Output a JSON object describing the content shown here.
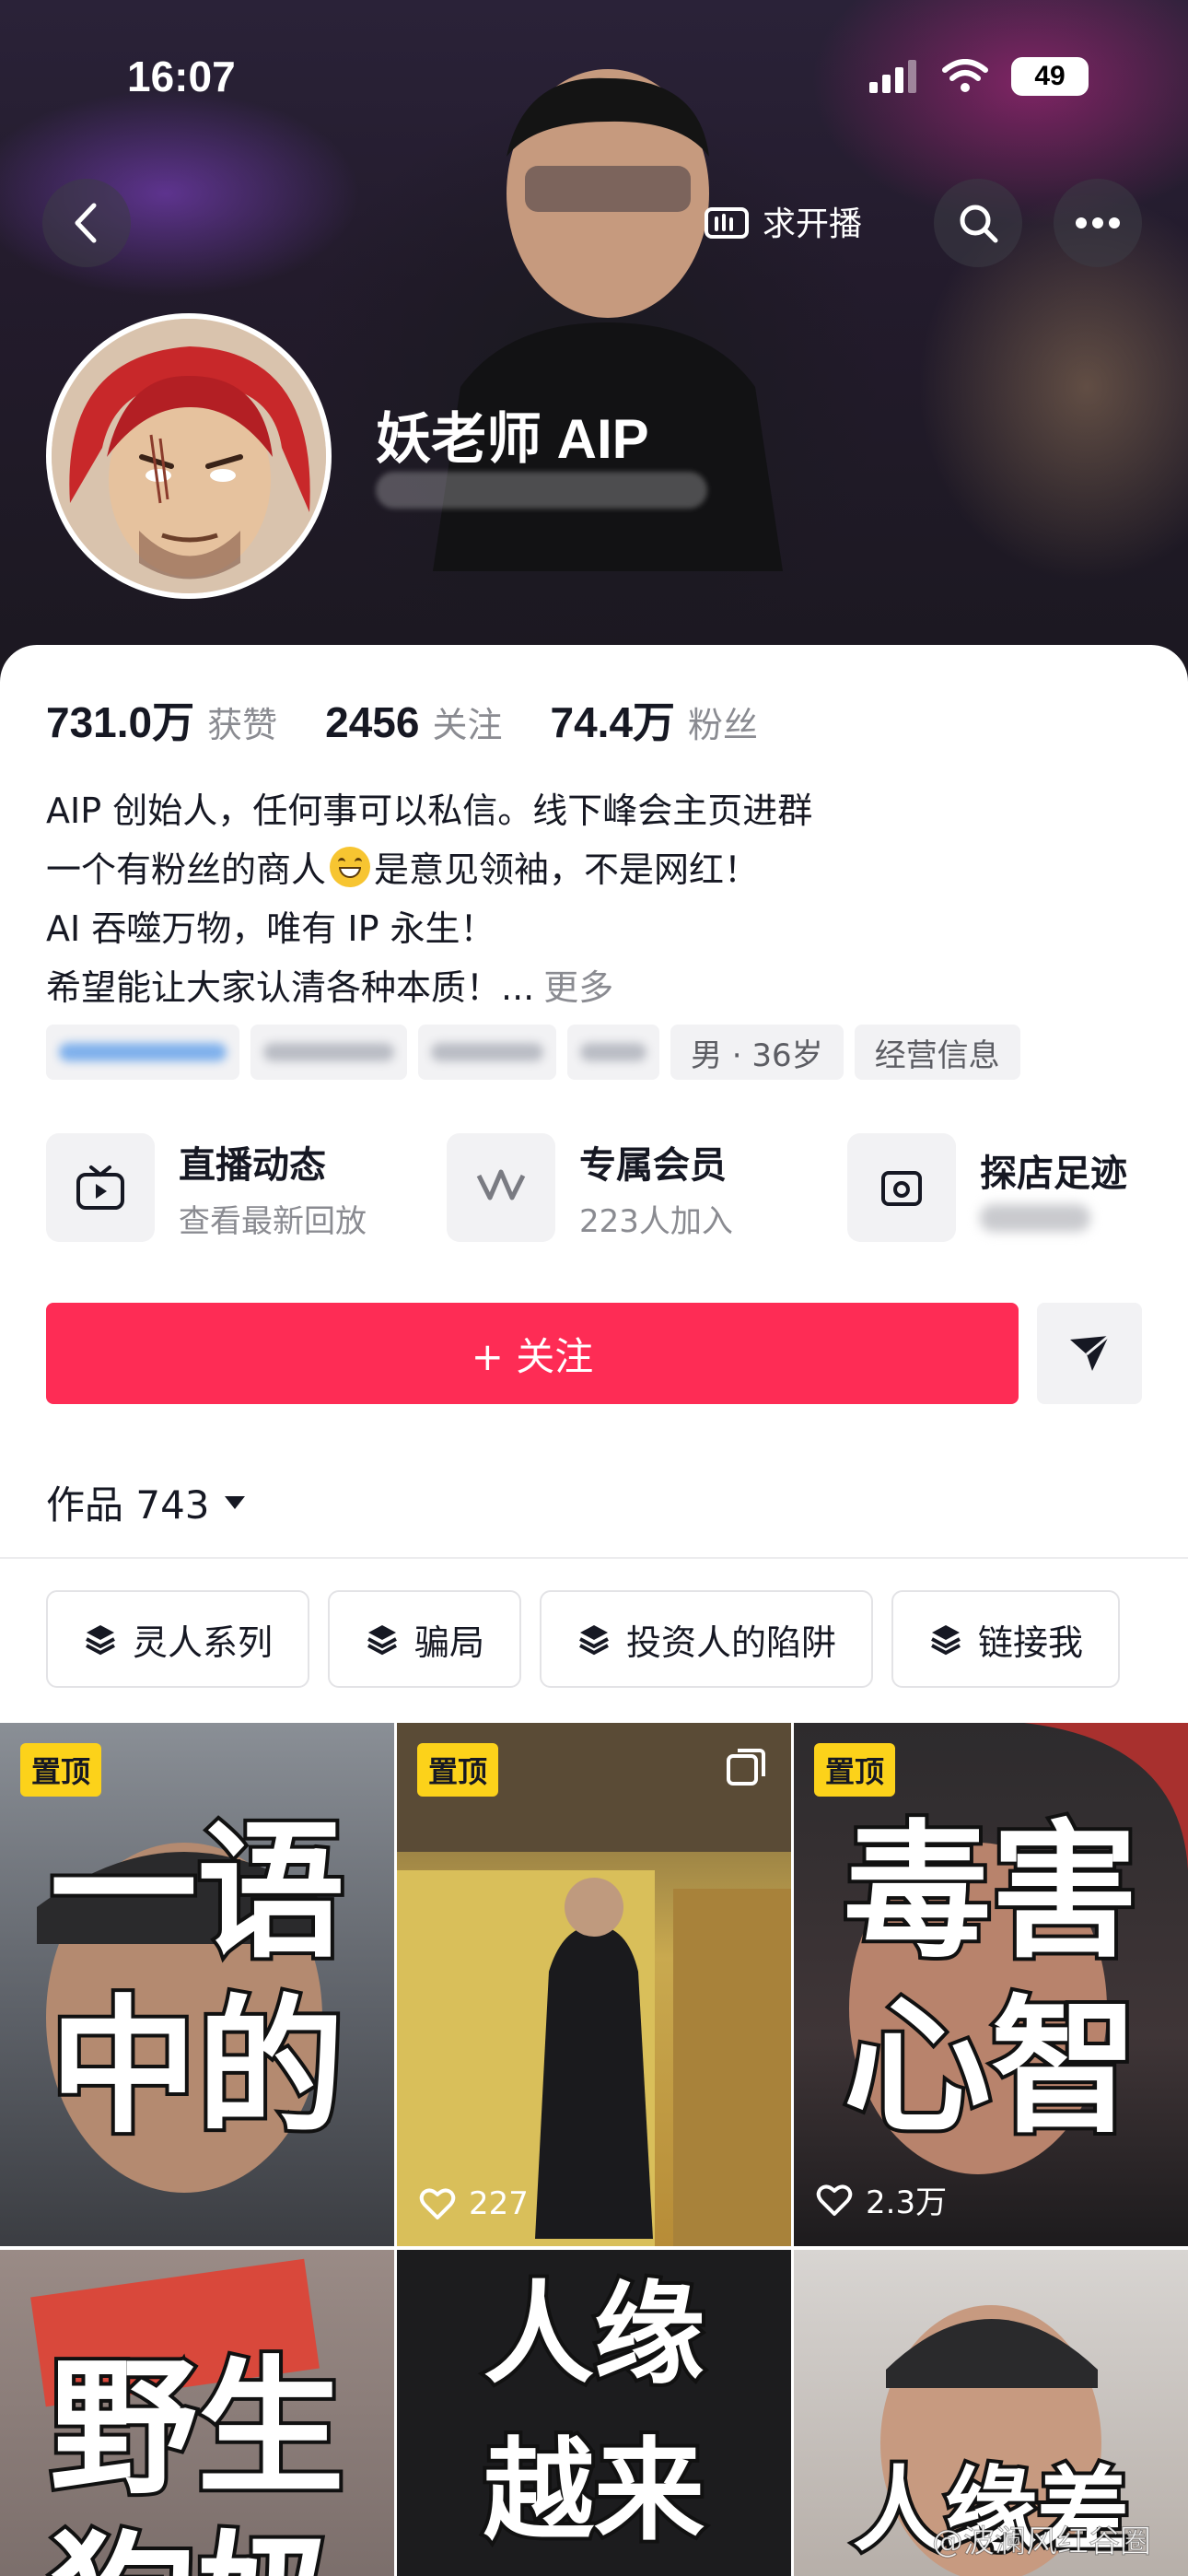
{
  "status_bar": {
    "time": "16:07",
    "battery": "49"
  },
  "header": {
    "live_request": "求开播"
  },
  "profile": {
    "name": "妖老师 AIP"
  },
  "stats": [
    {
      "value": "731.0万",
      "label": "获赞"
    },
    {
      "value": "2456",
      "label": "关注"
    },
    {
      "value": "74.4万",
      "label": "粉丝"
    }
  ],
  "bio": {
    "line1": "AIP 创始人，任何事可以私信。线下峰会主页进群",
    "line2a": "一个有粉丝的商人",
    "line2b": "是意见领袖，不是网红！",
    "line3": "AI 吞噬万物，唯有 IP 永生！",
    "line4": "希望能让大家认清各种本质！...",
    "more": "更多"
  },
  "tags": {
    "gender_age": "男 · 36岁",
    "business": "经营信息"
  },
  "features": [
    {
      "title": "直播动态",
      "subtitle": "查看最新回放"
    },
    {
      "title": "专属会员",
      "subtitle": "223人加入"
    },
    {
      "title": "探店足迹",
      "subtitle": ""
    }
  ],
  "follow_label": "+ 关注",
  "works": {
    "label": "作品 743"
  },
  "collections": [
    "灵人系列",
    "骗局",
    "投资人的陷阱",
    "链接我"
  ],
  "videos": [
    {
      "pinned": "置顶",
      "text": [
        "一语",
        "中的"
      ],
      "likes": ""
    },
    {
      "pinned": "置顶",
      "text": [],
      "likes": "227"
    },
    {
      "pinned": "置顶",
      "text": [
        "毒害",
        "心智"
      ],
      "likes": "2.3万"
    },
    {
      "pinned": "",
      "text": [
        "野生",
        "狗奶"
      ],
      "likes": ""
    },
    {
      "pinned": "",
      "text": [
        "人缘",
        "越来"
      ],
      "likes": ""
    },
    {
      "pinned": "",
      "text": [
        "人缘差"
      ],
      "likes": ""
    }
  ],
  "watermark": "@波澜风红谷圈",
  "colors": {
    "accent": "#fe2c55",
    "pin": "#fcd21a"
  }
}
